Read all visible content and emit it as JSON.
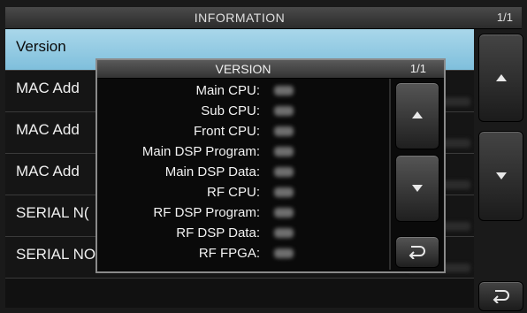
{
  "screen": {
    "title": "INFORMATION",
    "page_indicator": "1/1"
  },
  "list": {
    "items": [
      {
        "label": "Version",
        "selected": true
      },
      {
        "label": "MAC Add"
      },
      {
        "label": "MAC Add"
      },
      {
        "label": "MAC Add"
      },
      {
        "label": "SERIAL N("
      },
      {
        "label": "SERIAL NO. (RF Deck)"
      }
    ]
  },
  "side_buttons": {
    "up": "up-arrow-icon",
    "down": "down-arrow-icon",
    "back": "return-icon"
  },
  "dialog": {
    "title": "VERSION",
    "page_indicator": "1/1",
    "rows": [
      {
        "label": "Main CPU:"
      },
      {
        "label": "Sub CPU:"
      },
      {
        "label": "Front CPU:"
      },
      {
        "label": "Main DSP Program:"
      },
      {
        "label": "Main DSP Data:"
      },
      {
        "label": "RF CPU:"
      },
      {
        "label": "RF DSP Program:"
      },
      {
        "label": "RF DSP Data:"
      },
      {
        "label": "RF FPGA:"
      }
    ]
  },
  "colors": {
    "selected_row": "#9fd1e6",
    "background": "#111111",
    "text": "#f0f0f0"
  }
}
